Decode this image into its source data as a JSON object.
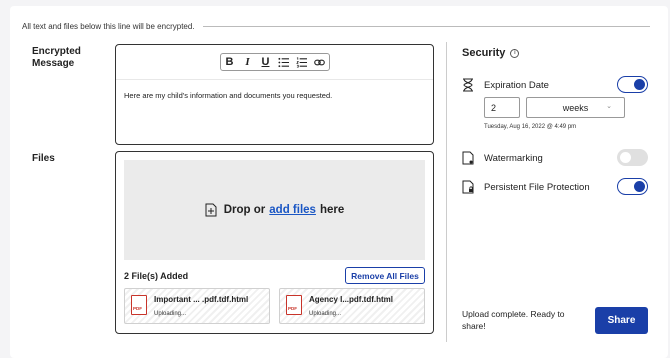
{
  "encryption_note": "All text and files below this line will be encrypted.",
  "message": {
    "label_line1": "Encrypted",
    "label_line2": "Message",
    "text": "Here are my child's information and documents you requested.",
    "toolbar": [
      "bold-icon",
      "italic-icon",
      "underline-icon",
      "bullet-list-icon",
      "numbered-list-icon",
      "link-icon"
    ]
  },
  "files": {
    "label": "Files",
    "drop_prefix": "Drop or",
    "drop_link": "add files",
    "drop_suffix": "here",
    "count": "2 File(s) Added",
    "remove_all": "Remove All Files",
    "items": [
      {
        "name": "Important ... .pdf.tdf.html",
        "status": "Uploading...",
        "icon": "PDF"
      },
      {
        "name": "Agency  I...pdf.tdf.html",
        "status": "Uploading...",
        "icon": "PDF"
      }
    ]
  },
  "security": {
    "title": "Security",
    "expiration": {
      "label": "Expiration Date",
      "enabled": true,
      "number": "2",
      "unit": "weeks",
      "date": "Tuesday, Aug 16, 2022 @ 4:49 pm"
    },
    "watermarking": {
      "label": "Watermarking",
      "enabled": false
    },
    "persistent": {
      "label": "Persistent File Protection",
      "enabled": true
    }
  },
  "footer": {
    "status": "Upload complete. Ready to share!",
    "share": "Share"
  },
  "colors": {
    "accent": "#1a3fa8",
    "link": "#1a56c4"
  }
}
